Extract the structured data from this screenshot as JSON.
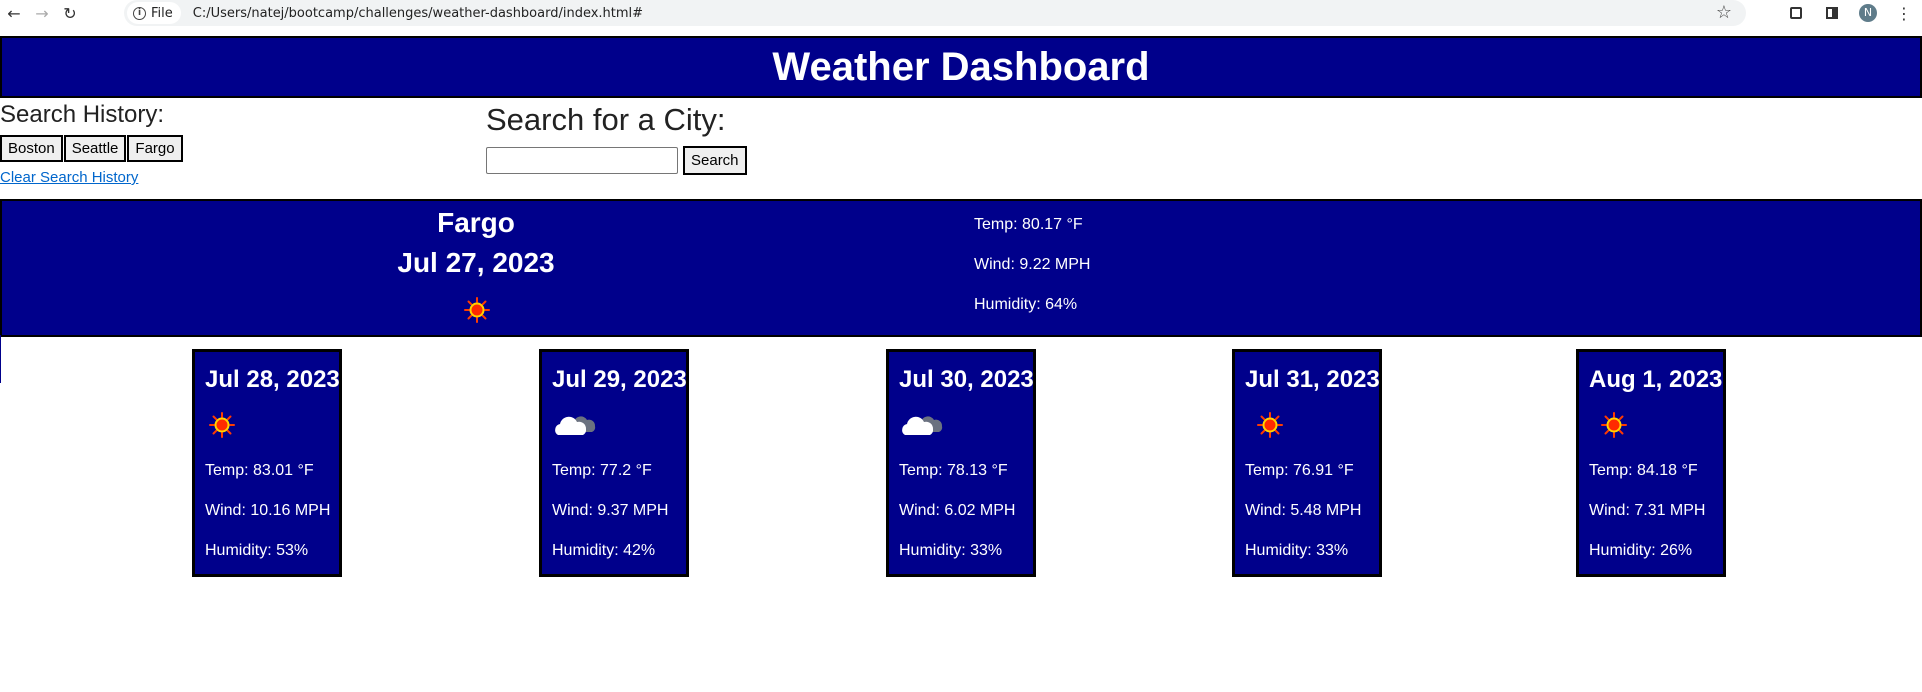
{
  "browser": {
    "site_label": "File",
    "url": "C:/Users/natej/bootcamp/challenges/weather-dashboard/index.html#",
    "profile_initial": "N"
  },
  "header": {
    "title": "Weather Dashboard"
  },
  "history": {
    "title": "Search History:",
    "cities": [
      "Boston",
      "Seattle",
      "Fargo"
    ],
    "clear_label": "Clear Search History"
  },
  "search": {
    "title": "Search for a City:",
    "input_value": "",
    "button_label": "Search"
  },
  "current": {
    "city": "Fargo",
    "date": "Jul 27, 2023",
    "icon": "sun-icon",
    "temp": "Temp: 80.17 °F",
    "wind": "Wind: 9.22 MPH",
    "humidity": "Humidity: 64%"
  },
  "forecast": [
    {
      "date": "Jul 28, 2023",
      "icon": "sun-icon",
      "temp": "Temp: 83.01 °F",
      "wind": "Wind: 10.16 MPH",
      "humidity": "Humidity: 53%"
    },
    {
      "date": "Jul 29, 2023",
      "icon": "cloud-icon",
      "temp": "Temp: 77.2 °F",
      "wind": "Wind: 9.37 MPH",
      "humidity": "Humidity: 42%"
    },
    {
      "date": "Jul 30, 2023",
      "icon": "cloud-icon",
      "temp": "Temp: 78.13 °F",
      "wind": "Wind: 6.02 MPH",
      "humidity": "Humidity: 33%"
    },
    {
      "date": "Jul 31, 2023",
      "icon": "sun-icon",
      "temp": "Temp: 76.91 °F",
      "wind": "Wind: 5.48 MPH",
      "humidity": "Humidity: 33%"
    },
    {
      "date": "Aug 1, 2023",
      "icon": "sun-icon",
      "temp": "Temp: 84.18 °F",
      "wind": "Wind: 7.31 MPH",
      "humidity": "Humidity: 26%"
    }
  ],
  "colors": {
    "panel": "#00008b",
    "text": "#ffffff",
    "link": "#0066cc"
  }
}
